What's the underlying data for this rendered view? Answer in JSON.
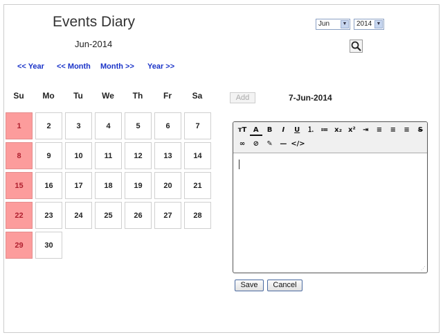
{
  "header": {
    "title": "Events Diary",
    "month_label": "Jun-2014"
  },
  "nav": {
    "prev_year": "<< Year",
    "prev_month": "<< Month",
    "next_month": "Month >>",
    "next_year": "Year >>"
  },
  "filters": {
    "month_value": "Jun",
    "year_value": "2014",
    "search_icon": "magnifier-icon"
  },
  "calendar": {
    "weekdays": [
      "Su",
      "Mo",
      "Tu",
      "We",
      "Th",
      "Fr",
      "Sa"
    ],
    "days": [
      "1",
      "2",
      "3",
      "4",
      "5",
      "6",
      "7",
      "8",
      "9",
      "10",
      "11",
      "12",
      "13",
      "14",
      "15",
      "16",
      "17",
      "18",
      "19",
      "20",
      "21",
      "22",
      "23",
      "24",
      "25",
      "26",
      "27",
      "28",
      "29",
      "30"
    ],
    "weekend_highlight_color": "#fc9c9c"
  },
  "event_panel": {
    "add_label": "Add",
    "selected_date": "7-Jun-2014",
    "toolbar": [
      {
        "name": "font-size",
        "glyph": "тT"
      },
      {
        "name": "font-color",
        "glyph": "A"
      },
      {
        "name": "bold",
        "glyph": "B"
      },
      {
        "name": "italic",
        "glyph": "I"
      },
      {
        "name": "underline",
        "glyph": "U"
      },
      {
        "name": "ordered-list",
        "glyph": "⒈"
      },
      {
        "name": "unordered-list",
        "glyph": "≔"
      },
      {
        "name": "subscript",
        "glyph": "x₂"
      },
      {
        "name": "superscript",
        "glyph": "x²"
      },
      {
        "name": "indent",
        "glyph": "⇥"
      },
      {
        "name": "align-left",
        "glyph": "≡"
      },
      {
        "name": "align-center",
        "glyph": "≡"
      },
      {
        "name": "justify",
        "glyph": "≡"
      },
      {
        "name": "strikethrough",
        "glyph": "S"
      },
      {
        "name": "link",
        "glyph": "∞"
      },
      {
        "name": "unlink",
        "glyph": "⊘"
      },
      {
        "name": "highlight",
        "glyph": "✎"
      },
      {
        "name": "horizontal-rule",
        "glyph": "—"
      },
      {
        "name": "source",
        "glyph": "</>"
      }
    ],
    "save_label": "Save",
    "cancel_label": "Cancel"
  }
}
